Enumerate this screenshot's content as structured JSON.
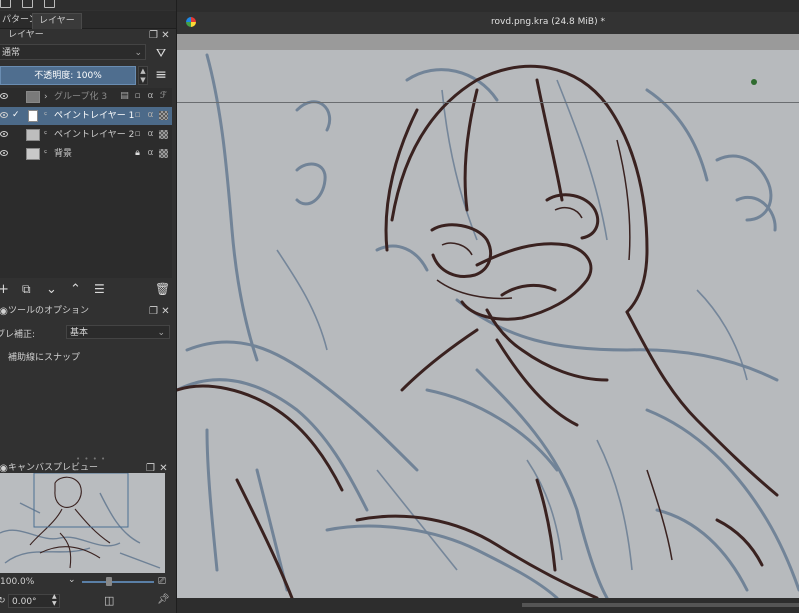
{
  "dock_tabs": {
    "pattern": "パターン",
    "layers": "レイヤー"
  },
  "layers_panel": {
    "title": "レイヤー",
    "blend_mode": "通常",
    "opacity": "不透明度: 100%",
    "layers": [
      {
        "name": "グループ化 3",
        "type": "group",
        "visible": true,
        "selected": false
      },
      {
        "name": "ペイントレイヤー 1",
        "type": "paint",
        "visible": true,
        "selected": true
      },
      {
        "name": "ペイントレイヤー 2",
        "type": "paint",
        "visible": true,
        "selected": false
      },
      {
        "name": "背景",
        "type": "paint",
        "visible": true,
        "selected": false,
        "locked": true
      }
    ]
  },
  "tool_options": {
    "title": "ツールのオプション",
    "stabilizer_label": "ブレ補正:",
    "stabilizer_value": "基本",
    "snap_label": "補助線にスナップ"
  },
  "canvas_preview": {
    "title": "キャンバスプレビュー",
    "zoom": "100.0%",
    "rotation": "0.00°"
  },
  "document": {
    "title": "rovd.png.kra (24.8 MiB) *"
  },
  "colors": {
    "accent": "#4f6e8f",
    "panel": "#313131",
    "canvas_bg": "#b7babd",
    "sketch_blue": "#6e8196",
    "sketch_brown": "#3a2220"
  }
}
